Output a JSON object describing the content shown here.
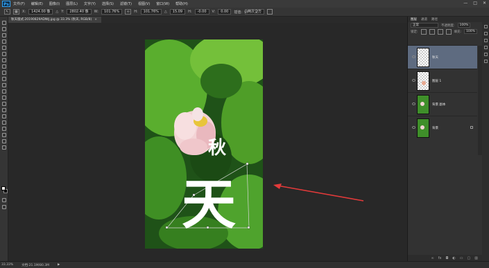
{
  "app": {
    "logo": "Ps"
  },
  "menubar": {
    "items": [
      "文件(F)",
      "编辑(E)",
      "图像(I)",
      "图层(L)",
      "文字(Y)",
      "选择(S)",
      "滤镜(T)",
      "视图(V)",
      "窗口(W)",
      "帮助(H)"
    ]
  },
  "window_controls": {
    "minimize": "—",
    "maximize": "□",
    "close": "✕"
  },
  "options": {
    "x_label": "X:",
    "x_value": "1424.00 像",
    "y_label": "Y:",
    "y_value": "2802.40 像",
    "w_label": "W:",
    "w_value": "101.76%",
    "h_label": "H:",
    "h_value": "101.76%",
    "angle_label": "△",
    "angle_value": "15.09",
    "hskew_label": "H:",
    "hskew_value": "-0.00",
    "vskew_label": "V:",
    "vskew_value": "0.00",
    "interp_label": "插值:",
    "interp_value": "两次立方"
  },
  "document": {
    "tab_title": "秋天版式.20190829ADNtJ.jpg @ 33.3% (秋天, RGB/8)",
    "close": "×"
  },
  "canvas": {
    "char_top": "秋",
    "char_main": "天"
  },
  "status": {
    "zoom": "33.33%",
    "doc_info": "文档:21.1M/80.3M",
    "arrow": "▶"
  },
  "panel": {
    "tabs": [
      "图层",
      "通道",
      "路径"
    ],
    "blend_mode": "正常",
    "opacity_label": "不透明度:",
    "opacity_value": "100%",
    "lock_label": "锁定:",
    "fill_label": "填充:",
    "fill_value": "100%",
    "layers": [
      {
        "name": "秋天",
        "selected": true,
        "thumb": "checker"
      },
      {
        "name": "图层 1",
        "selected": false,
        "thumb": "checker"
      },
      {
        "name": "背景 副本",
        "selected": false,
        "thumb": "green"
      },
      {
        "name": "背景",
        "selected": false,
        "thumb": "green"
      }
    ],
    "footer_icons": [
      "link-icon",
      "fx-icon",
      "mask-icon",
      "adjustment-icon",
      "folder-icon",
      "new-layer-icon",
      "trash-icon"
    ]
  },
  "colors": {
    "accent": "#5e6b80",
    "arrow": "#e23a3a",
    "ps_blue": "#31a8ff"
  }
}
